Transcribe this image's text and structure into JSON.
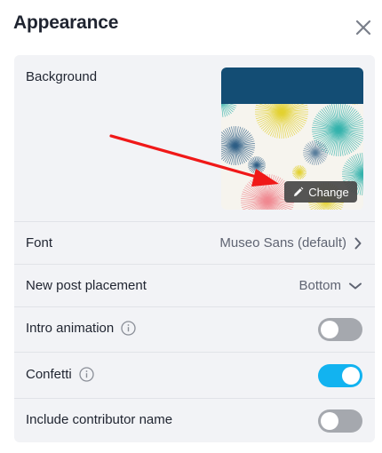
{
  "header": {
    "title": "Appearance"
  },
  "icons": {
    "close": "close-icon",
    "chevron_right": "chevron-right-icon",
    "chevron_down": "chevron-down-icon",
    "info": "info-icon",
    "pencil": "pencil-icon"
  },
  "background": {
    "label": "Background",
    "change_label": "Change"
  },
  "font": {
    "label": "Font",
    "value": "Museo Sans (default)"
  },
  "placement": {
    "label": "New post placement",
    "value": "Bottom"
  },
  "intro_animation": {
    "label": "Intro animation",
    "enabled": false
  },
  "confetti": {
    "label": "Confetti",
    "enabled": true
  },
  "contributor": {
    "label": "Include contributor name",
    "enabled": false
  },
  "colors": {
    "toggle_on": "#12b3f0",
    "toggle_off": "#a5a8ae",
    "thumb_header": "#134d74",
    "annotation_arrow": "#f01818"
  }
}
